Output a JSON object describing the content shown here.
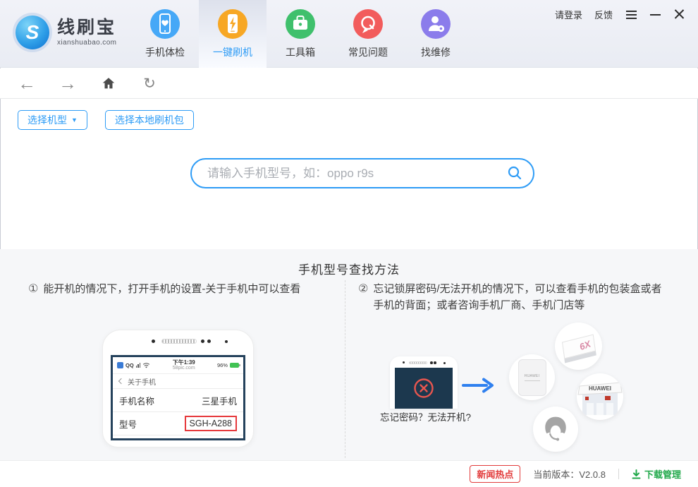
{
  "header": {
    "brand": {
      "name": "线刷宝",
      "domain": "xianshuabao.com",
      "logo_letter": "S"
    },
    "login": "请登录",
    "feedback": "反馈",
    "nav": [
      {
        "label": "手机体检",
        "icon": "phone-heart-icon",
        "color": "#46a8f7",
        "selected": false
      },
      {
        "label": "一键刷机",
        "icon": "phone-flash-icon",
        "color": "#f7a724",
        "selected": true
      },
      {
        "label": "工具箱",
        "icon": "toolbox-icon",
        "color": "#3fc06c",
        "selected": false
      },
      {
        "label": "常见问题",
        "icon": "question-bubble-icon",
        "color": "#f25c5c",
        "selected": false
      },
      {
        "label": "找维修",
        "icon": "repair-person-icon",
        "color": "#8b7ceb",
        "selected": false
      }
    ]
  },
  "actions": {
    "select_model": "选择机型",
    "select_local_package": "选择本地刷机包"
  },
  "search": {
    "placeholder": "请输入手机型号，如：oppo r9s"
  },
  "guide": {
    "title": "手机型号查找方法",
    "steps": [
      {
        "num": "①",
        "text": "能开机的情况下，打开手机的设置-关于手机中可以查看"
      },
      {
        "num": "②",
        "text": "忘记锁屏密码/无法开机的情况下，可以查看手机的包装盒或者手机的背面；或者咨询手机厂商、手机门店等"
      }
    ],
    "phone_mock": {
      "qq": "QQ",
      "time": "下午1:39",
      "site": "58pic.com",
      "battery": "96%",
      "back_title": "关于手机",
      "rows": [
        {
          "label": "手机名称",
          "value": "三星手机"
        },
        {
          "label": "型号",
          "value": "SGH-A288"
        }
      ]
    },
    "locked_caption": "忘记密码？无法开机?",
    "box_label": "6X",
    "back_label": "HUAWEI",
    "store_label": "HUAWEI"
  },
  "footer": {
    "news": "新闻热点",
    "version": "当前版本：V2.0.8",
    "download": "下载管理"
  },
  "colors": {
    "accent_blue": "#2e9cf6",
    "nav_blue": "#46a8f7",
    "nav_orange": "#f7a724",
    "nav_green": "#3fc06c",
    "nav_red": "#f25c5c",
    "nav_purple": "#8b7ceb",
    "news_red": "#e23b3b",
    "download_green": "#21a84a",
    "screen_navy": "#1c384e",
    "error_red": "#e8564f",
    "model_box_red": "#e6393c"
  }
}
